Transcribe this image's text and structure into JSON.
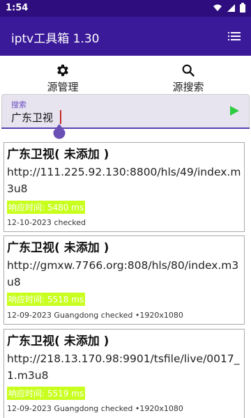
{
  "status": {
    "time": "1:54",
    "icons": [
      "wifi-icon",
      "signal-icon",
      "battery-icon"
    ]
  },
  "app": {
    "title": "iptv工具箱 1.30",
    "menu_icon": "list-menu-icon"
  },
  "tabs": [
    {
      "label": "源管理",
      "icon": "gear-icon"
    },
    {
      "label": "源搜索",
      "icon": "search-icon"
    }
  ],
  "search": {
    "label": "搜索",
    "value": "广东卫视",
    "action_icon": "play-icon"
  },
  "results": [
    {
      "title": "广东卫视( 未添加 )",
      "url": "http://111.225.92.130:8800/hls/49/index.m3u8",
      "latency": "响应时间: 5480 ms",
      "meta": "12-10-2023 checked"
    },
    {
      "title": "广东卫视( 未添加 )",
      "url": "http://gmxw.7766.org:808/hls/80/index.m3u8",
      "latency": "响应时间: 5518 ms",
      "meta": "12-09-2023 Guangdong checked •1920x1080"
    },
    {
      "title": "广东卫视( 未添加 )",
      "url": "http://218.13.170.98:9901/tsfile/live/0017_1.m3u8",
      "latency": "响应时间: 5519 ms",
      "meta": "12-09-2023 Guangdong checked •1920x1080"
    }
  ],
  "colors": {
    "status_bar": "#2e0d7e",
    "app_bar": "#3b1a99",
    "accent": "#5a3fb0",
    "latency_highlight": "#c8ff1e",
    "go_button": "#2ecc40"
  }
}
